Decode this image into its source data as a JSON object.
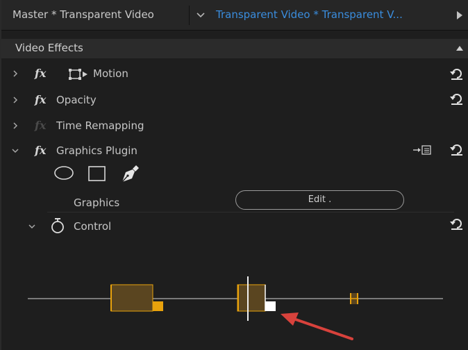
{
  "header": {
    "master_label": "Master * Transparent Video",
    "clip_label": "Transparent Video * Transparent V...",
    "clip_color": "#3a8dde"
  },
  "section": {
    "title": "Video Effects"
  },
  "effects": [
    {
      "label": "Motion",
      "expanded": false,
      "enabled": true
    },
    {
      "label": "Opacity",
      "expanded": false,
      "enabled": true
    },
    {
      "label": "Time Remapping",
      "expanded": false,
      "enabled": false
    },
    {
      "label": "Graphics Plugin",
      "expanded": true,
      "enabled": true
    }
  ],
  "graphics_plugin": {
    "tools": [
      "ellipse-tool-icon",
      "rectangle-tool-icon",
      "pen-tool-icon"
    ],
    "graphics_label": "Graphics",
    "edit_button_label": "Edit .",
    "control_label": "Control"
  },
  "colors": {
    "keyframe_orange": "#e8a20c",
    "keyframe_fill": "#5a4520",
    "arrow_red": "#d8423c"
  },
  "icons": {
    "fx": "fx",
    "reset": "reset-icon",
    "stopwatch": "stopwatch-icon"
  }
}
